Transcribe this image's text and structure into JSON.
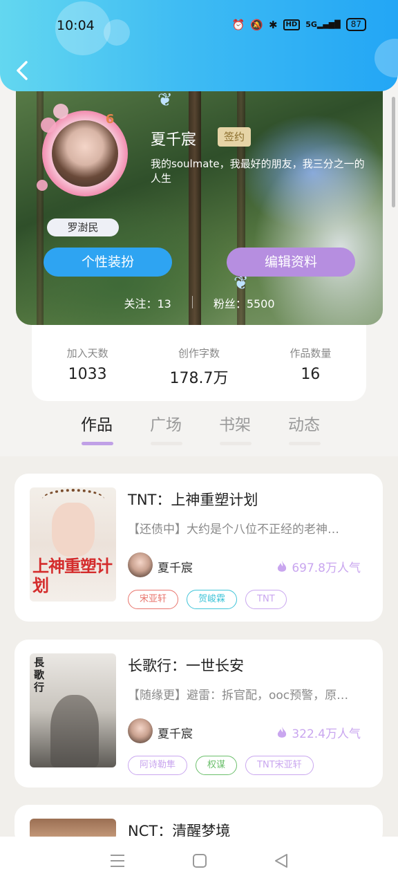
{
  "status_bar": {
    "time": "10:04",
    "battery": "87",
    "signal_label": "5G"
  },
  "profile": {
    "name": "夏千宸",
    "sign_badge": "签约",
    "bio": "我的soulmate，我最好的朋友，我三分之一的人生",
    "level": "6",
    "nick_tag": "罗澍民",
    "dress_button": "个性装扮",
    "edit_button": "编辑资料",
    "following": "关注：13",
    "fans": "粉丝：5500"
  },
  "stats": [
    {
      "label": "加入天数",
      "value": "1033"
    },
    {
      "label": "创作字数",
      "value": "178.7万"
    },
    {
      "label": "作品数量",
      "value": "16"
    }
  ],
  "tabs": [
    {
      "label": "作品",
      "active": true
    },
    {
      "label": "广场",
      "active": false
    },
    {
      "label": "书架",
      "active": false
    },
    {
      "label": "动态",
      "active": false
    }
  ],
  "works": [
    {
      "title": "TNT：上神重塑计划",
      "desc": "【还债中】大约是个八位不正经的老神…",
      "cover_text": "上神重塑计划",
      "author": "夏千宸",
      "popularity": "697.8万人气",
      "tags": [
        {
          "label": "宋亚轩",
          "color": "#e8746c"
        },
        {
          "label": "贺峻霖",
          "color": "#3fc4d8"
        },
        {
          "label": "TNT",
          "color": "#c9a6ef"
        }
      ]
    },
    {
      "title": "长歌行：一世长安",
      "desc": "【随缘更】避雷：拆官配，ooc预警，原…",
      "cover_text": "長歌行",
      "author": "夏千宸",
      "popularity": "322.4万人气",
      "tags": [
        {
          "label": "阿诗勒隼",
          "color": "#c9a6ef"
        },
        {
          "label": "权谋",
          "color": "#6bbf6b"
        },
        {
          "label": "TNT宋亚轩",
          "color": "#c9a6ef"
        }
      ]
    },
    {
      "title": "NCT：清醒梦境"
    }
  ],
  "colors": {
    "header_blue": "#23a6f5",
    "dress_button": "#2ea4f2",
    "edit_button": "#b68ee0",
    "accent_purple": "#c0a0e6"
  }
}
